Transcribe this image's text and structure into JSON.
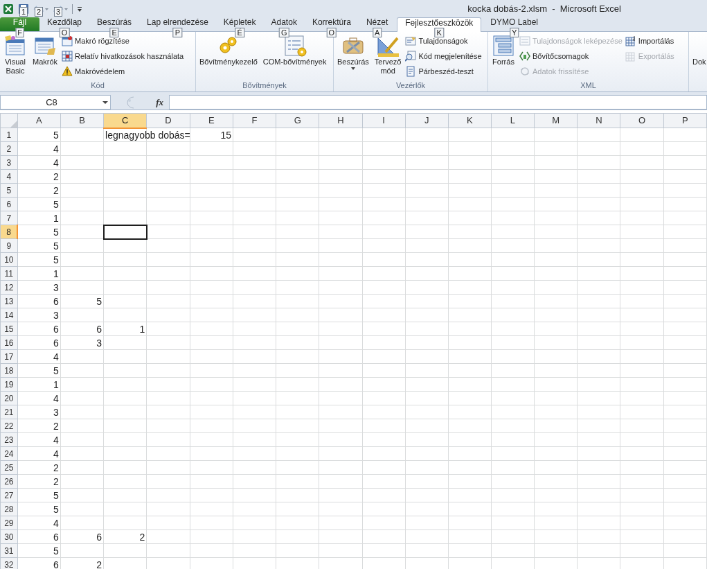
{
  "window": {
    "title": "kocka dobás-2.xlsm  -  Microsoft Excel"
  },
  "quick_access": [
    {
      "kind": "save",
      "keytip": "1",
      "disabled": false
    },
    {
      "kind": "undo",
      "keytip": "2",
      "disabled": true
    },
    {
      "kind": "redo",
      "keytip": "3",
      "disabled": true
    }
  ],
  "tabs": [
    {
      "label": "Fájl",
      "keytip": "F",
      "kind": "file",
      "selected": false
    },
    {
      "label": "Kezdőlap",
      "keytip": "O",
      "kind": "tab",
      "selected": false
    },
    {
      "label": "Beszúrás",
      "keytip": "E",
      "kind": "tab",
      "selected": false
    },
    {
      "label": "Lap elrendezése",
      "keytip": "P",
      "kind": "tab",
      "selected": false
    },
    {
      "label": "Képletek",
      "keytip": "É",
      "kind": "tab",
      "selected": false
    },
    {
      "label": "Adatok",
      "keytip": "G",
      "kind": "tab",
      "selected": false
    },
    {
      "label": "Korrektúra",
      "keytip": "O",
      "kind": "tab",
      "selected": false
    },
    {
      "label": "Nézet",
      "keytip": "A",
      "kind": "tab",
      "selected": false
    },
    {
      "label": "Fejlesztőeszközök",
      "keytip": "K",
      "kind": "tab",
      "selected": true
    },
    {
      "label": "DYMO Label",
      "keytip": "Y",
      "kind": "tab",
      "selected": false
    }
  ],
  "ribbon_groups": [
    {
      "title": "Kód",
      "large": [
        {
          "label": "Visual\nBasic",
          "dropdown": false
        },
        {
          "label": "Makrók",
          "dropdown": false
        }
      ],
      "columns": [
        [
          {
            "label": "Makró rögzítése",
            "disabled": false
          },
          {
            "label": "Relatív hivatkozások használata",
            "disabled": false
          },
          {
            "label": "Makróvédelem",
            "disabled": false
          }
        ]
      ]
    },
    {
      "title": "Bővítmények",
      "large": [
        {
          "label": "Bővítménykezelő",
          "dropdown": false
        },
        {
          "label": "COM-bővítmények",
          "dropdown": false
        }
      ]
    },
    {
      "title": "Vezérlők",
      "large": [
        {
          "label": "Beszúrás",
          "dropdown": true
        },
        {
          "label": "Tervező\nmód",
          "dropdown": false
        }
      ],
      "columns": [
        [
          {
            "label": "Tulajdonságok",
            "disabled": false
          },
          {
            "label": "Kód megjelenítése",
            "disabled": false
          },
          {
            "label": "Párbeszéd-teszt",
            "disabled": false
          }
        ]
      ]
    },
    {
      "title": "XML",
      "large": [
        {
          "label": "Forrás",
          "dropdown": false
        }
      ],
      "columns": [
        [
          {
            "label": "Tulajdonságok leképezése",
            "disabled": true
          },
          {
            "label": "Bővítőcsomagok",
            "disabled": false
          },
          {
            "label": "Adatok frissítése",
            "disabled": true
          }
        ],
        [
          {
            "label": "Importálás",
            "disabled": false
          },
          {
            "label": "Exportálás",
            "disabled": true
          }
        ]
      ]
    },
    {
      "large": [
        {
          "label": "Dok",
          "dropdown": false
        }
      ]
    }
  ],
  "name_box": "C8",
  "formula_bar": {
    "fx": "fx"
  },
  "columns": [
    {
      "label": "A",
      "selected": false
    },
    {
      "label": "B",
      "selected": false
    },
    {
      "label": "C",
      "selected": true
    },
    {
      "label": "D",
      "selected": false
    },
    {
      "label": "E",
      "selected": false
    },
    {
      "label": "F",
      "selected": false
    },
    {
      "label": "G",
      "selected": false
    },
    {
      "label": "H",
      "selected": false
    },
    {
      "label": "I",
      "selected": false
    },
    {
      "label": "J",
      "selected": false
    },
    {
      "label": "K",
      "selected": false
    },
    {
      "label": "L",
      "selected": false
    },
    {
      "label": "M",
      "selected": false
    },
    {
      "label": "N",
      "selected": false
    },
    {
      "label": "O",
      "selected": false
    },
    {
      "label": "P",
      "selected": false
    }
  ],
  "rows": [
    {
      "header": "1",
      "selected": false,
      "cells": {
        "A": {
          "value": "5",
          "kind": "number"
        },
        "C": {
          "value": "legnagyobb dobás=",
          "kind": "text"
        },
        "E": {
          "value": "15",
          "kind": "number"
        }
      }
    },
    {
      "header": "2",
      "selected": false,
      "cells": {
        "A": {
          "value": "4",
          "kind": "number"
        }
      }
    },
    {
      "header": "3",
      "selected": false,
      "cells": {
        "A": {
          "value": "4",
          "kind": "number"
        }
      }
    },
    {
      "header": "4",
      "selected": false,
      "cells": {
        "A": {
          "value": "2",
          "kind": "number"
        }
      }
    },
    {
      "header": "5",
      "selected": false,
      "cells": {
        "A": {
          "value": "2",
          "kind": "number"
        }
      }
    },
    {
      "header": "6",
      "selected": false,
      "cells": {
        "A": {
          "value": "5",
          "kind": "number"
        }
      }
    },
    {
      "header": "7",
      "selected": false,
      "cells": {
        "A": {
          "value": "1",
          "kind": "number"
        }
      }
    },
    {
      "header": "8",
      "selected": true,
      "cells": {
        "A": {
          "value": "5",
          "kind": "number"
        }
      }
    },
    {
      "header": "9",
      "selected": false,
      "cells": {
        "A": {
          "value": "5",
          "kind": "number"
        }
      }
    },
    {
      "header": "10",
      "selected": false,
      "cells": {
        "A": {
          "value": "5",
          "kind": "number"
        }
      }
    },
    {
      "header": "11",
      "selected": false,
      "cells": {
        "A": {
          "value": "1",
          "kind": "number"
        }
      }
    },
    {
      "header": "12",
      "selected": false,
      "cells": {
        "A": {
          "value": "3",
          "kind": "number"
        }
      }
    },
    {
      "header": "13",
      "selected": false,
      "cells": {
        "A": {
          "value": "6",
          "kind": "number"
        },
        "B": {
          "value": "5",
          "kind": "number"
        }
      }
    },
    {
      "header": "14",
      "selected": false,
      "cells": {
        "A": {
          "value": "3",
          "kind": "number"
        }
      }
    },
    {
      "header": "15",
      "selected": false,
      "cells": {
        "A": {
          "value": "6",
          "kind": "number"
        },
        "B": {
          "value": "6",
          "kind": "number"
        },
        "C": {
          "value": "1",
          "kind": "number"
        }
      }
    },
    {
      "header": "16",
      "selected": false,
      "cells": {
        "A": {
          "value": "6",
          "kind": "number"
        },
        "B": {
          "value": "3",
          "kind": "number"
        }
      }
    },
    {
      "header": "17",
      "selected": false,
      "cells": {
        "A": {
          "value": "4",
          "kind": "number"
        }
      }
    },
    {
      "header": "18",
      "selected": false,
      "cells": {
        "A": {
          "value": "5",
          "kind": "number"
        }
      }
    },
    {
      "header": "19",
      "selected": false,
      "cells": {
        "A": {
          "value": "1",
          "kind": "number"
        }
      }
    },
    {
      "header": "20",
      "selected": false,
      "cells": {
        "A": {
          "value": "4",
          "kind": "number"
        }
      }
    },
    {
      "header": "21",
      "selected": false,
      "cells": {
        "A": {
          "value": "3",
          "kind": "number"
        }
      }
    },
    {
      "header": "22",
      "selected": false,
      "cells": {
        "A": {
          "value": "2",
          "kind": "number"
        }
      }
    },
    {
      "header": "23",
      "selected": false,
      "cells": {
        "A": {
          "value": "4",
          "kind": "number"
        }
      }
    },
    {
      "header": "24",
      "selected": false,
      "cells": {
        "A": {
          "value": "4",
          "kind": "number"
        }
      }
    },
    {
      "header": "25",
      "selected": false,
      "cells": {
        "A": {
          "value": "2",
          "kind": "number"
        }
      }
    },
    {
      "header": "26",
      "selected": false,
      "cells": {
        "A": {
          "value": "2",
          "kind": "number"
        }
      }
    },
    {
      "header": "27",
      "selected": false,
      "cells": {
        "A": {
          "value": "5",
          "kind": "number"
        }
      }
    },
    {
      "header": "28",
      "selected": false,
      "cells": {
        "A": {
          "value": "5",
          "kind": "number"
        }
      }
    },
    {
      "header": "29",
      "selected": false,
      "cells": {
        "A": {
          "value": "4",
          "kind": "number"
        }
      }
    },
    {
      "header": "30",
      "selected": false,
      "cells": {
        "A": {
          "value": "6",
          "kind": "number"
        },
        "B": {
          "value": "6",
          "kind": "number"
        },
        "C": {
          "value": "2",
          "kind": "number"
        }
      }
    },
    {
      "header": "31",
      "selected": false,
      "cells": {
        "A": {
          "value": "5",
          "kind": "number"
        }
      }
    },
    {
      "header": "32",
      "selected": false,
      "cells": {
        "A": {
          "value": "6",
          "kind": "number"
        },
        "B": {
          "value": "2",
          "kind": "number"
        }
      }
    }
  ]
}
